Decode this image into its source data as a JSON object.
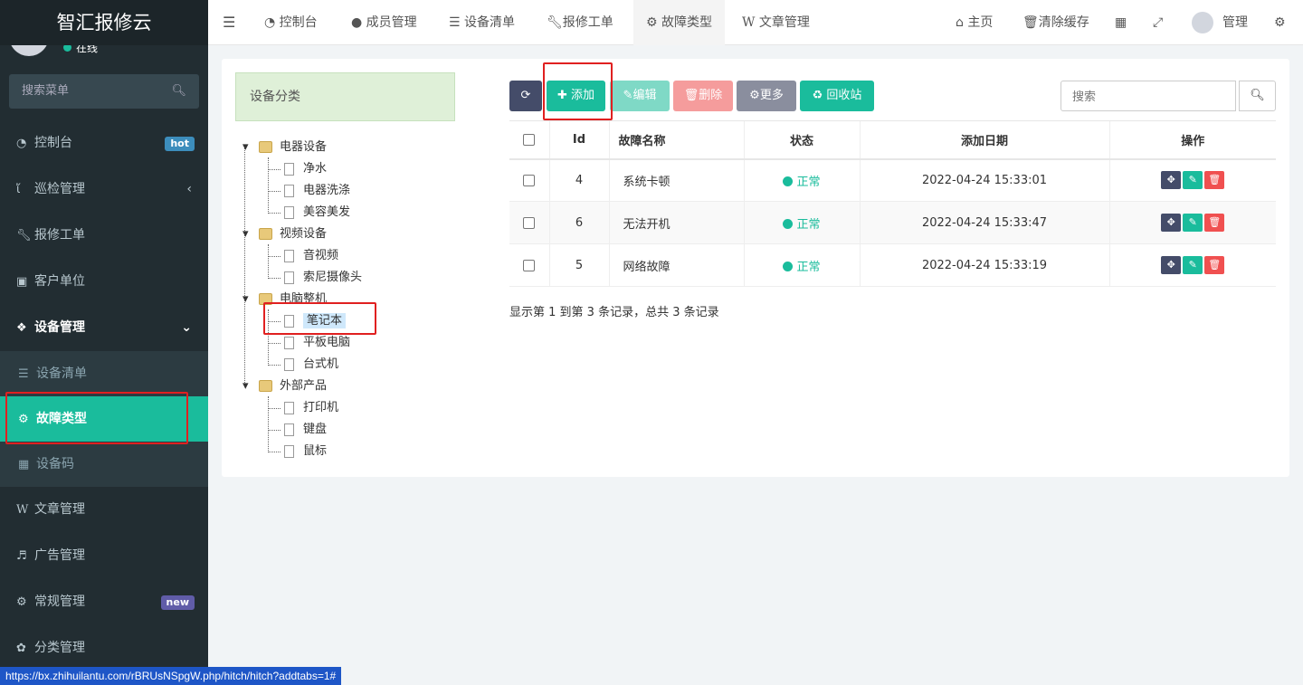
{
  "app": {
    "title": "智汇报修云",
    "status": "在线",
    "search_placeholder": "搜索菜单"
  },
  "sidebar": {
    "items": [
      {
        "label": "控制台",
        "badge": "hot",
        "badge_color": "#3c8dbc"
      },
      {
        "label": "巡检管理"
      },
      {
        "label": "报修工单"
      },
      {
        "label": "客户单位"
      },
      {
        "label": "设备管理"
      },
      {
        "label": "文章管理"
      },
      {
        "label": "广告管理"
      },
      {
        "label": "常规管理",
        "badge": "new",
        "badge_color": "#605ca8"
      },
      {
        "label": "分类管理"
      }
    ],
    "sub_items": [
      {
        "label": "设备清单"
      },
      {
        "label": "故障类型",
        "active": true
      },
      {
        "label": "设备码"
      }
    ]
  },
  "topnav": {
    "tabs": [
      {
        "label": "控制台"
      },
      {
        "label": "成员管理"
      },
      {
        "label": "设备清单"
      },
      {
        "label": "报修工单"
      },
      {
        "label": "故障类型",
        "active": true
      },
      {
        "label": "文章管理"
      }
    ],
    "home": "主页",
    "clear_cache": "清除缓存",
    "user": "管理"
  },
  "category": {
    "title": "设备分类",
    "tree": [
      {
        "label": "电器设备",
        "children": [
          "净水",
          "电器洗涤",
          "美容美发"
        ]
      },
      {
        "label": "视频设备",
        "children": [
          "音视频",
          "索尼摄像头"
        ]
      },
      {
        "label": "电脑整机",
        "children": [
          "笔记本",
          "平板电脑",
          "台式机"
        ]
      },
      {
        "label": "外部产品",
        "children": [
          "打印机",
          "键盘",
          "鼠标"
        ]
      }
    ],
    "selected": "笔记本"
  },
  "toolbar": {
    "add": "添加",
    "edit": "编辑",
    "delete": "删除",
    "more": "更多",
    "recycle": "回收站",
    "search_placeholder": "搜索"
  },
  "table": {
    "headers": [
      "Id",
      "故障名称",
      "状态",
      "添加日期",
      "操作"
    ],
    "rows": [
      {
        "id": "4",
        "name": "系统卡顿",
        "status": "正常",
        "date": "2022-04-24 15:33:01"
      },
      {
        "id": "6",
        "name": "无法开机",
        "status": "正常",
        "date": "2022-04-24 15:33:47"
      },
      {
        "id": "5",
        "name": "网络故障",
        "status": "正常",
        "date": "2022-04-24 15:33:19"
      }
    ],
    "summary": "显示第 1 到第 3 条记录，总共 3 条记录"
  },
  "status_url": "https://bx.zhihuilantu.com/rBRUsNSpgW.php/hitch/hitch?addtabs=1#",
  "colors": {
    "accent": "#1abc9c",
    "sidebar": "#222d32",
    "danger": "#f05050",
    "primary_dark": "#444c69",
    "highlight_box": "#e02020"
  }
}
